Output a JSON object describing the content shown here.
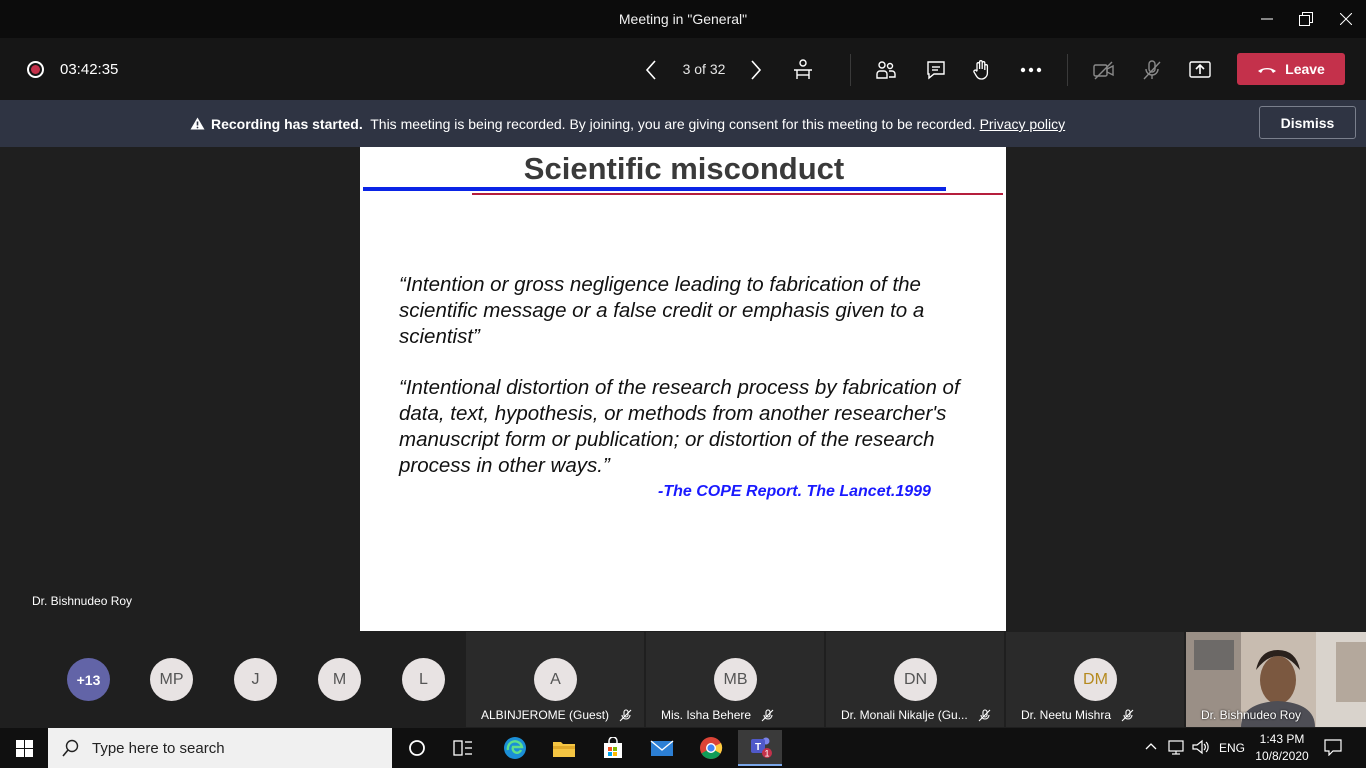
{
  "window": {
    "title": "Meeting in \"General\""
  },
  "toolbar": {
    "timer": "03:42:35",
    "pager": "3 of 32",
    "leave_label": "Leave"
  },
  "banner": {
    "bold": "Recording has started.",
    "text": "This meeting is being recorded. By joining, you are giving consent for this meeting to be recorded.",
    "link": "Privacy policy",
    "dismiss_label": "Dismiss"
  },
  "slide": {
    "title": "Scientific misconduct",
    "quote1": "“Intention or gross negligence leading to fabrication of the scientific message or a false credit or emphasis given to a scientist”",
    "quote2": "“Intentional distortion of the research process by fabrication of data, text, hypothesis, or methods from another researcher's manuscript form or publication; or distortion of the research process in other ways.”",
    "citation": "-The COPE Report. The Lancet.1999"
  },
  "presenter": {
    "name": "Dr. Bishnudeo Roy"
  },
  "participants": {
    "overflow": "+13",
    "avatars": [
      "MP",
      "J",
      "M",
      "L"
    ],
    "tiles": [
      {
        "initials": "A",
        "name": "ALBINJEROME (Guest)"
      },
      {
        "initials": "MB",
        "name": "Mis. Isha Behere"
      },
      {
        "initials": "DN",
        "name": "Dr. Monali Nikalje (Gu..."
      },
      {
        "initials": "DM",
        "name": "Dr. Neetu Mishra"
      }
    ],
    "video": {
      "name": "Dr. Bishnudeo Roy"
    }
  },
  "taskbar": {
    "search_placeholder": "Type here to search",
    "teams_badge": "1",
    "language": "ENG",
    "time": "1:43 PM",
    "date": "10/8/2020"
  },
  "colors": {
    "leave": "#c4314b",
    "banner": "#2f3443",
    "overflow_avatar": "#6264a7",
    "citation": "#1a1aff"
  }
}
